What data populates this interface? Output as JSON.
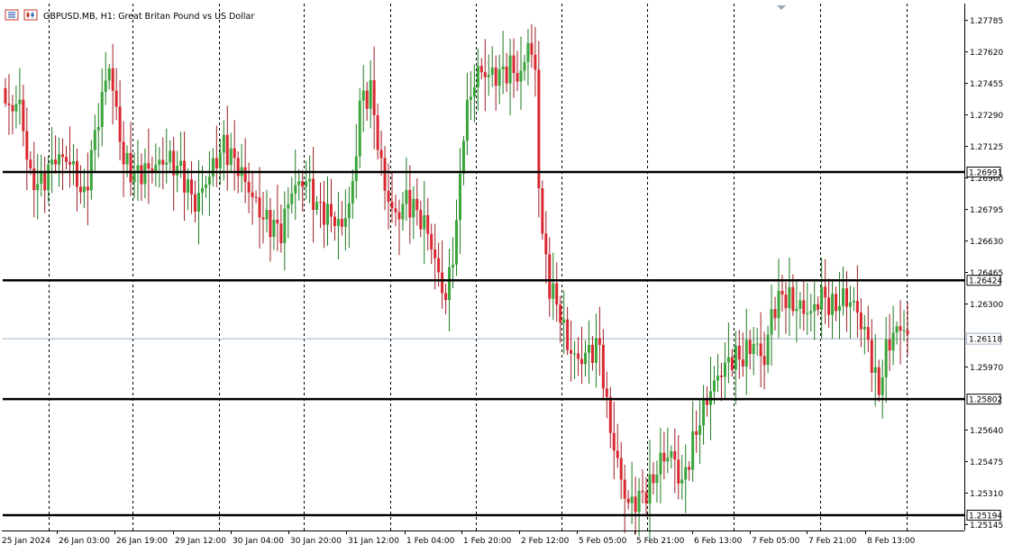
{
  "header": {
    "title": "GBPUSD.MB, H1:  Great Britan Pound vs US Dollar",
    "icons": [
      "bars-icon",
      "chart-type-icon"
    ]
  },
  "colors": {
    "bull": "#3aa53a",
    "bear": "#d9282f",
    "wick_bull": "#1f7a1f",
    "wick_bear": "#a01c22",
    "grid": "#000000",
    "level_line": "#000000",
    "price_line": "#9bb2c8"
  },
  "chart_data": {
    "type": "candlestick",
    "symbol": "GBPUSD.MB",
    "timeframe": "H1",
    "ylim": [
      1.25114,
      1.27873
    ],
    "yticks": [
      1.27785,
      1.2762,
      1.27455,
      1.2729,
      1.27125,
      1.2696,
      1.26795,
      1.2663,
      1.26465,
      1.263,
      1.2597,
      1.2564,
      1.25475,
      1.2531,
      1.25145
    ],
    "ytick_labels": [
      "1.27785",
      "1.27620",
      "1.27455",
      "1.27290",
      "1.27125",
      "1.26960",
      "1.26795",
      "1.26630",
      "1.26465",
      "1.26300",
      "1.25970",
      "1.25640",
      "1.25475",
      "1.25310",
      "1.25145"
    ],
    "xticks": [
      "25 Jan 2024",
      "26 Jan 03:00",
      "26 Jan 19:00",
      "29 Jan 12:00",
      "30 Jan 04:00",
      "30 Jan 20:00",
      "31 Jan 12:00",
      "1 Feb 04:00",
      "1 Feb 20:00",
      "2 Feb 12:00",
      "5 Feb 05:00",
      "5 Feb 21:00",
      "6 Feb 13:00",
      "7 Feb 05:00",
      "7 Feb 21:00",
      "8 Feb 13:00"
    ],
    "horizontal_levels": [
      {
        "value": 1.26991,
        "label": "1.26991"
      },
      {
        "value": 1.26424,
        "label": "1.26424"
      },
      {
        "value": 1.25802,
        "label": "1.25802"
      },
      {
        "value": 1.25194,
        "label": "1.25194"
      }
    ],
    "current_price": {
      "value": 1.26118,
      "label": "1.26118"
    },
    "anchors": [
      [
        0,
        1.2732
      ],
      [
        4,
        1.2735
      ],
      [
        7,
        1.2695
      ],
      [
        10,
        1.2693
      ],
      [
        14,
        1.2707
      ],
      [
        18,
        1.2705
      ],
      [
        22,
        1.2685
      ],
      [
        24,
        1.2708
      ],
      [
        27,
        1.2738
      ],
      [
        29,
        1.2755
      ],
      [
        33,
        1.2705
      ],
      [
        36,
        1.2698
      ],
      [
        41,
        1.2701
      ],
      [
        45,
        1.2706
      ],
      [
        49,
        1.27
      ],
      [
        53,
        1.2682
      ],
      [
        57,
        1.2698
      ],
      [
        61,
        1.2713
      ],
      [
        65,
        1.2702
      ],
      [
        68,
        1.269
      ],
      [
        72,
        1.2675
      ],
      [
        77,
        1.2668
      ],
      [
        80,
        1.269
      ],
      [
        84,
        1.2695
      ],
      [
        87,
        1.2681
      ],
      [
        91,
        1.2676
      ],
      [
        94,
        1.267
      ],
      [
        97,
        1.269
      ],
      [
        99,
        1.2735
      ],
      [
        102,
        1.2742
      ],
      [
        104,
        1.2715
      ],
      [
        106,
        1.269
      ],
      [
        109,
        1.2675
      ],
      [
        112,
        1.2685
      ],
      [
        115,
        1.2678
      ],
      [
        118,
        1.2668
      ],
      [
        121,
        1.2645
      ],
      [
        123,
        1.2632
      ],
      [
        126,
        1.267
      ],
      [
        128,
        1.2722
      ],
      [
        130,
        1.274
      ],
      [
        132,
        1.2752
      ],
      [
        135,
        1.275
      ],
      [
        138,
        1.275
      ],
      [
        141,
        1.2754
      ],
      [
        144,
        1.2748
      ],
      [
        146,
        1.2768
      ],
      [
        147,
        1.276
      ],
      [
        148,
        1.275
      ],
      [
        149,
        1.2695
      ],
      [
        150,
        1.2665
      ],
      [
        152,
        1.264
      ],
      [
        155,
        1.2625
      ],
      [
        157,
        1.2608
      ],
      [
        160,
        1.26
      ],
      [
        163,
        1.2605
      ],
      [
        166,
        1.2608
      ],
      [
        168,
        1.2575
      ],
      [
        170,
        1.2555
      ],
      [
        173,
        1.253
      ],
      [
        174,
        1.2525
      ],
      [
        177,
        1.2528
      ],
      [
        180,
        1.2534
      ],
      [
        183,
        1.2548
      ],
      [
        186,
        1.2552
      ],
      [
        189,
        1.2535
      ],
      [
        191,
        1.255
      ],
      [
        194,
        1.257
      ],
      [
        197,
        1.2585
      ],
      [
        200,
        1.2595
      ],
      [
        203,
        1.2602
      ],
      [
        206,
        1.2602
      ],
      [
        209,
        1.261
      ],
      [
        212,
        1.26
      ],
      [
        214,
        1.2625
      ],
      [
        217,
        1.2635
      ],
      [
        220,
        1.263
      ],
      [
        222,
        1.2628
      ],
      [
        225,
        1.2625
      ],
      [
        228,
        1.2635
      ],
      [
        231,
        1.2628
      ],
      [
        234,
        1.2633
      ],
      [
        237,
        1.263
      ],
      [
        239,
        1.262
      ],
      [
        241,
        1.261
      ],
      [
        243,
        1.259
      ],
      [
        244,
        1.2585
      ],
      [
        246,
        1.2605
      ],
      [
        248,
        1.2615
      ],
      [
        251,
        1.2618
      ],
      [
        252,
        1.2612
      ]
    ]
  }
}
